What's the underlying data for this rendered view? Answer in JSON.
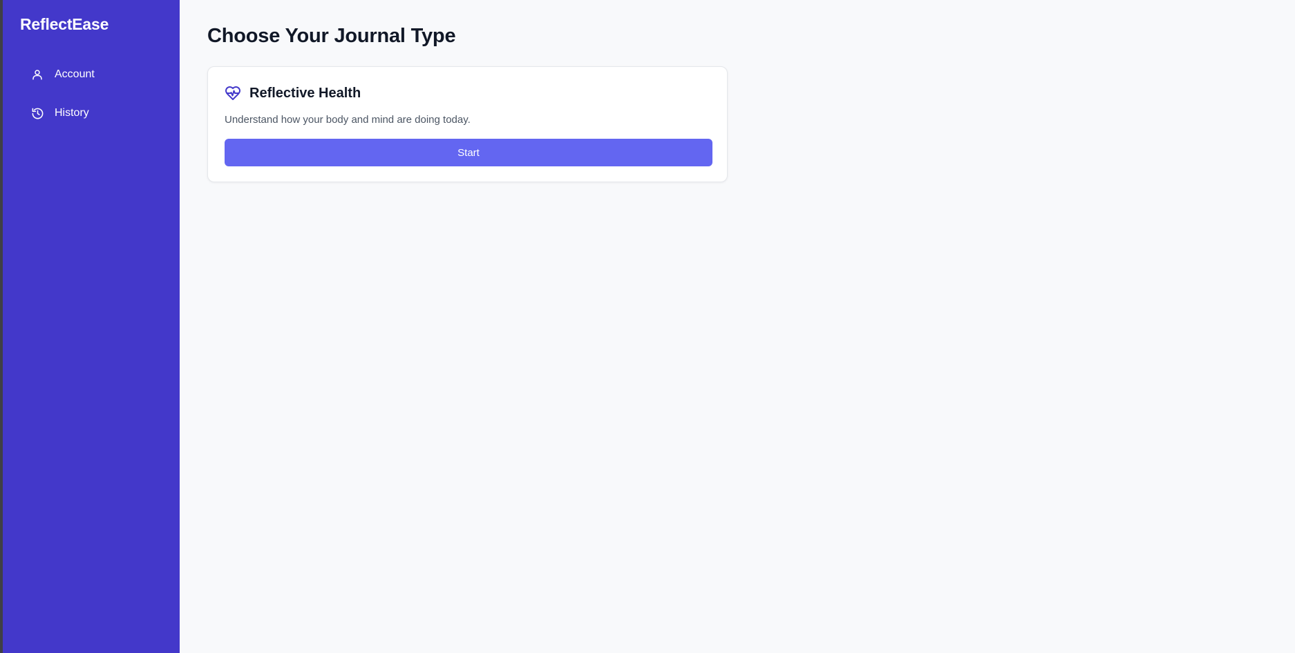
{
  "app": {
    "brand": "ReflectEase"
  },
  "sidebar": {
    "items": [
      {
        "label": "Account",
        "icon": "user-icon"
      },
      {
        "label": "History",
        "icon": "history-icon"
      }
    ]
  },
  "main": {
    "title": "Choose Your Journal Type",
    "cards": [
      {
        "title": "Reflective Health",
        "icon": "heart-pulse-icon",
        "description": "Understand how your body and mind are doing today.",
        "button_label": "Start"
      }
    ]
  },
  "colors": {
    "sidebar_bg": "#4338ca",
    "accent": "#6366f1",
    "page_bg": "#f8f9fb",
    "text_primary": "#111827",
    "text_secondary": "#4b5563"
  }
}
